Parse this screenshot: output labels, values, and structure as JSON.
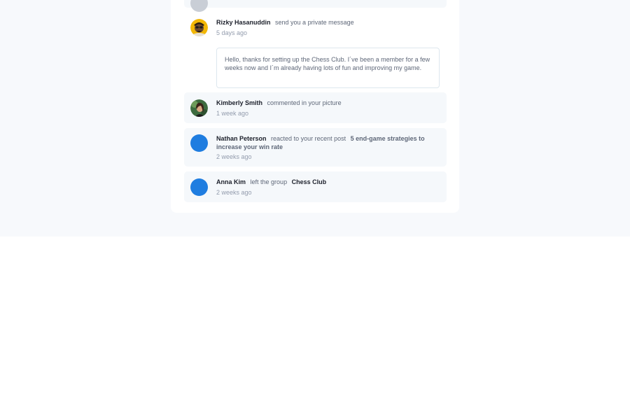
{
  "notifications": [
    {
      "id": "top-partial",
      "name": "",
      "action": "",
      "time": "",
      "unread": true
    },
    {
      "id": "rizky",
      "name": "Rizky Hasanuddin",
      "action": "send you a private message",
      "time": "5 days ago",
      "message": "Hello, thanks for setting up the Chess Club. I´ve been a member for a few weeks now and I´m already having lots of fun and improving my game.",
      "unread": false
    },
    {
      "id": "kimberly",
      "name": "Kimberly Smith",
      "action": "commented in your picture",
      "time": "1 week ago",
      "unread": true
    },
    {
      "id": "nathan",
      "name": "Nathan Peterson",
      "action": "reacted to your recent post",
      "target": "5 end-game strategies to increase your win rate",
      "time": "2 weeks ago",
      "unread": true
    },
    {
      "id": "anna",
      "name": "Anna Kim",
      "action": "left the group",
      "target": "Chess Club",
      "time": "2 weeks ago",
      "unread": true
    }
  ],
  "colors": {
    "background": "#f7f9fc",
    "card": "#ffffff",
    "unread_bg": "#f5f8fb",
    "avatar_placeholder": "#1f7de0",
    "name_text": "#1c202b",
    "body_text": "#5e6778",
    "time_text": "#939cad"
  }
}
